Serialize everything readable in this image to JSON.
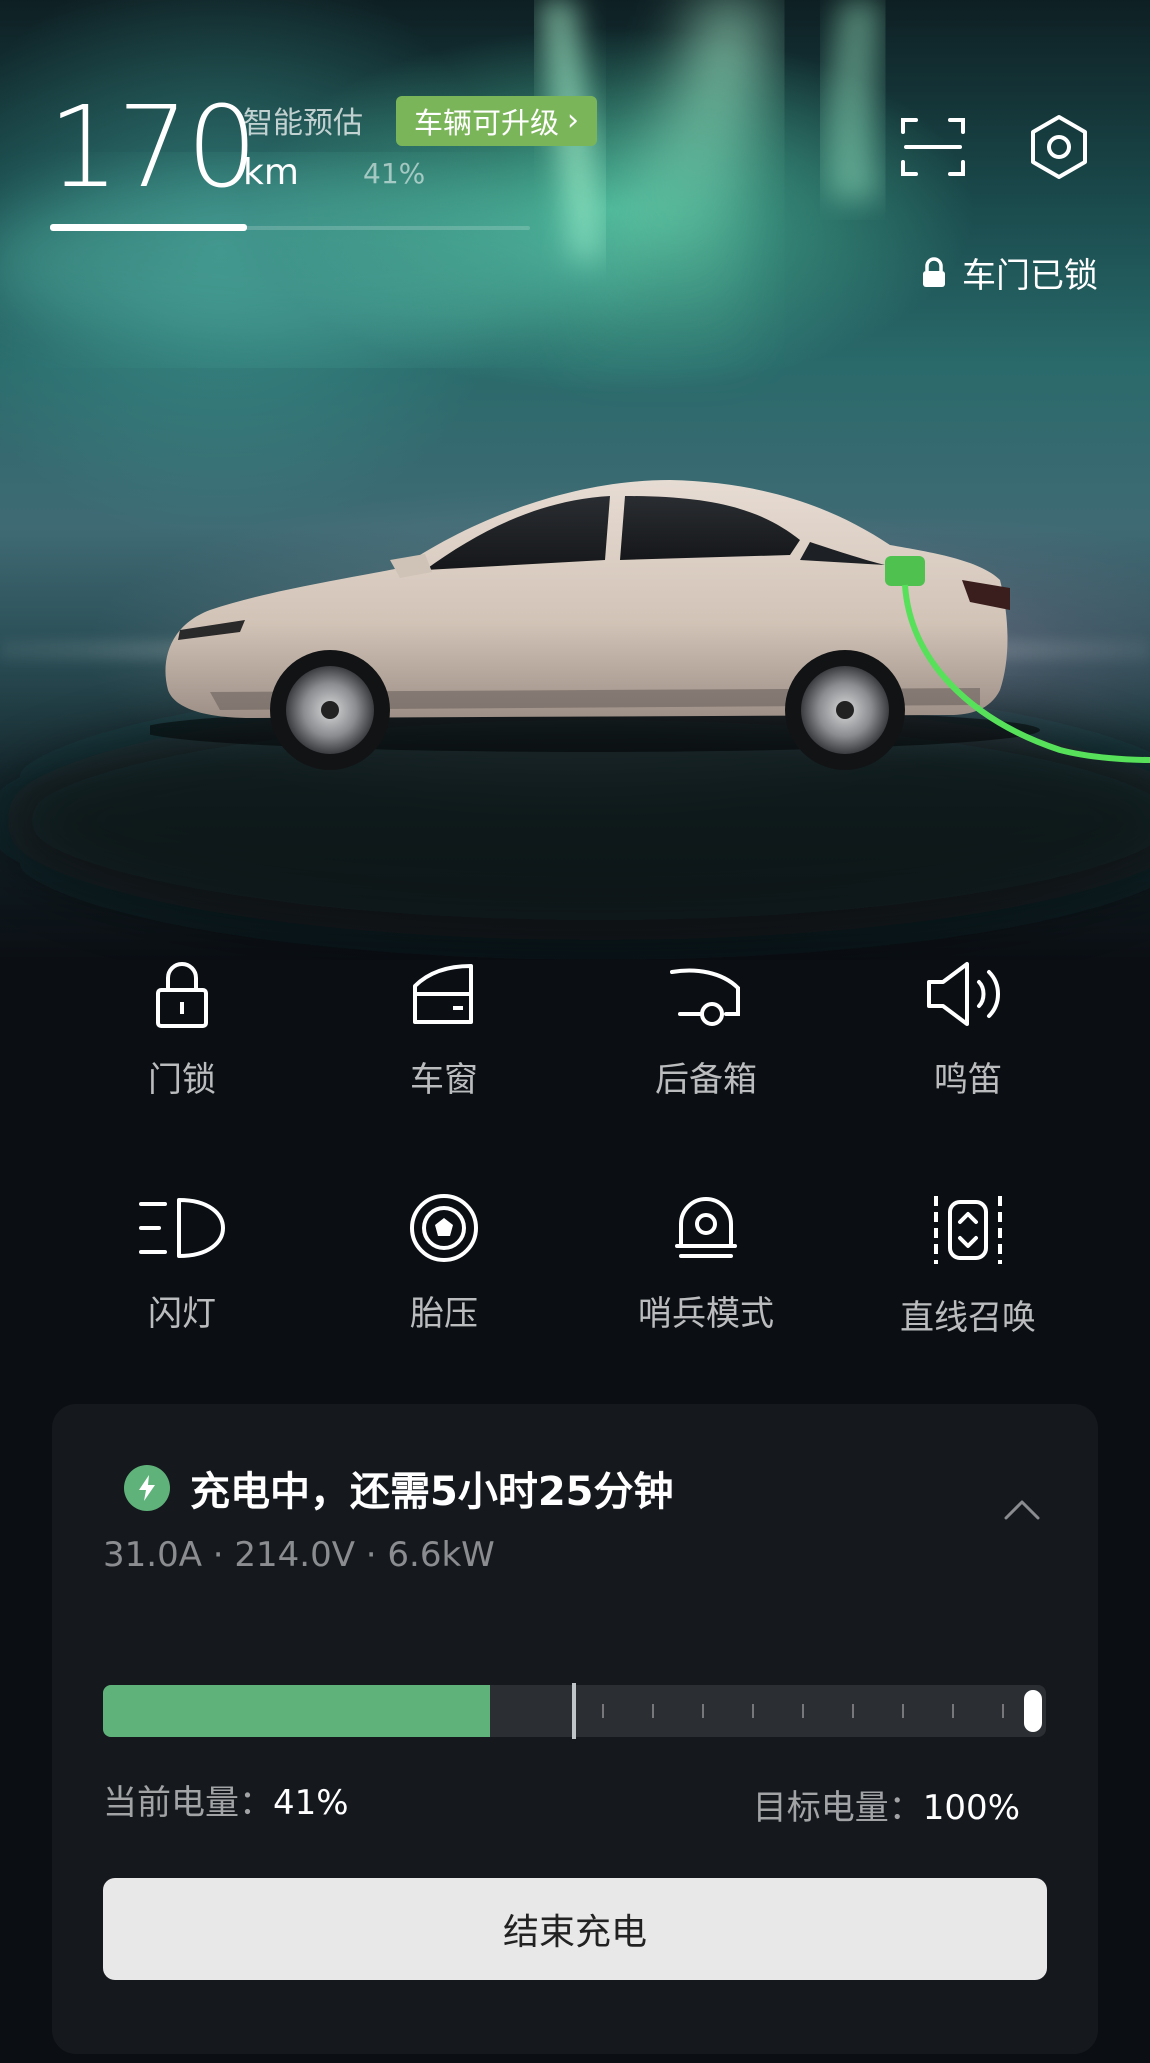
{
  "range": {
    "value": "170",
    "unit": "km",
    "label": "智能预估",
    "percent": "41%",
    "fraction": 0.41
  },
  "upgrade_badge": {
    "label": "车辆可升级"
  },
  "top_icons": [
    "scan-icon",
    "settings-icon"
  ],
  "door_status": {
    "label": "车门已锁"
  },
  "controls": [
    {
      "label": "门锁",
      "icon": "lock-icon"
    },
    {
      "label": "车窗",
      "icon": "window-icon"
    },
    {
      "label": "后备箱",
      "icon": "trunk-icon"
    },
    {
      "label": "鸣笛",
      "icon": "horn-icon"
    },
    {
      "label": "闪灯",
      "icon": "headlight-icon"
    },
    {
      "label": "胎压",
      "icon": "tire-icon"
    },
    {
      "label": "哨兵模式",
      "icon": "sentry-icon"
    },
    {
      "label": "直线召唤",
      "icon": "summon-icon"
    }
  ],
  "charging": {
    "status": "充电中，还需5小时25分钟",
    "metrics": "31.0A · 214.0V · 6.6kW",
    "current_label": "当前电量：",
    "current_value": "41%",
    "current_fraction": 0.41,
    "target_label": "目标电量：",
    "target_value": "100%",
    "target_fraction": 1.0,
    "end_button": "结束充电"
  },
  "colors": {
    "accent_green": "#5fb37a",
    "badge_green": "#7bb55a",
    "card_bg": "#15191e"
  }
}
